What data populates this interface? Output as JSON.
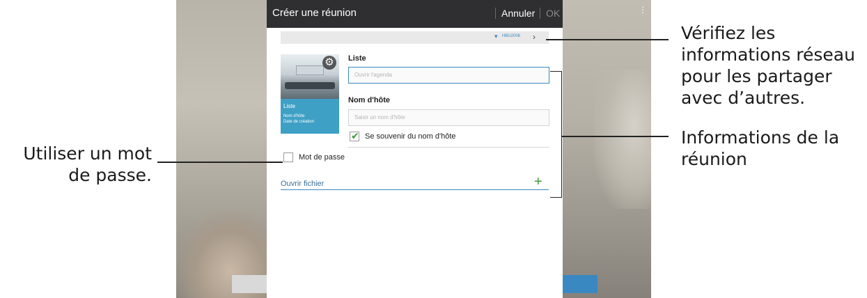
{
  "callouts": {
    "password": "Utiliser un mot de passe.",
    "network": "Vérifiez les informations réseau pour les partager avec d’autres.",
    "meeting_info": "Informations de la réunion"
  },
  "dialog": {
    "title": "Créer une réunion",
    "cancel_label": "Annuler",
    "ok_label": "OK",
    "network_name": "HBU2006",
    "thumbnail": {
      "title": "Liste",
      "host_label": "Nom d'hôte",
      "date_label": "Date de création"
    },
    "liste_label": "Liste",
    "liste_placeholder": "Ouvrir l'agenda",
    "host_label": "Nom d'hôte",
    "host_placeholder": "Saisir un nom d'hôte",
    "remember_label": "Se souvenir du nom d'hôte",
    "remember_checked": true,
    "password_label": "Mot de passe",
    "password_checked": false,
    "open_file_label": "Ouvrir fichier"
  },
  "colors": {
    "accent": "#3a88c1",
    "titlebar": "#2f2f31",
    "check_green": "#3d9a3d",
    "thumb_blue": "#3fa0c6"
  },
  "icons": {
    "settings": "gear-icon",
    "network": "wifi-icon",
    "navigate": "chevron-right-icon",
    "add": "plus-icon",
    "checked": "check-icon",
    "more": "more-vertical-icon"
  }
}
